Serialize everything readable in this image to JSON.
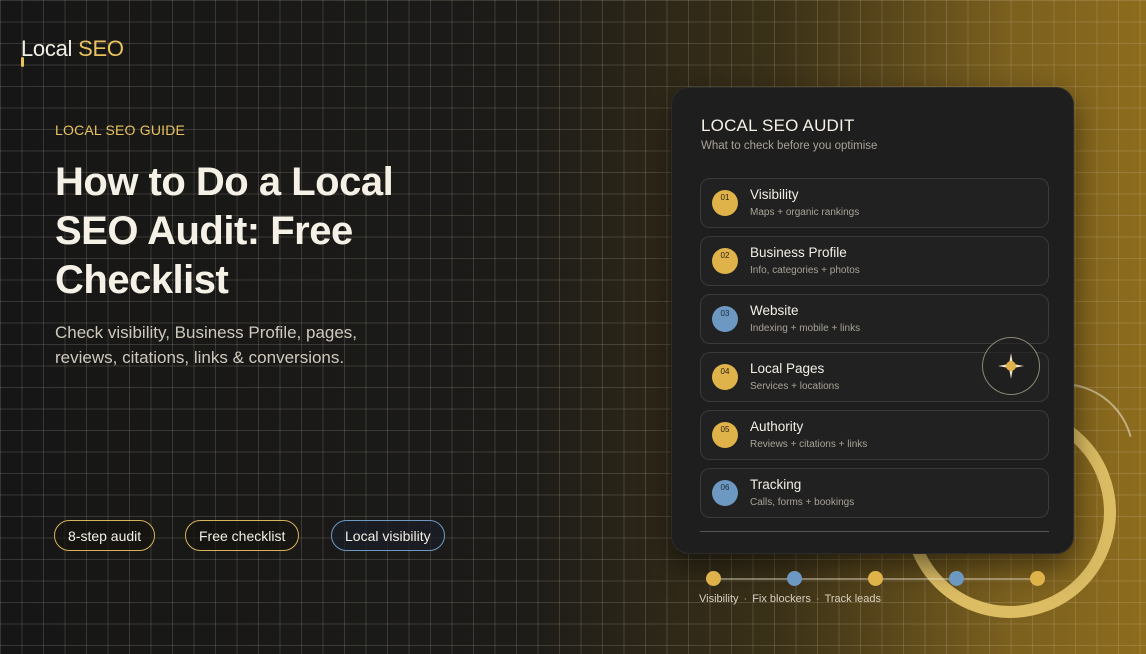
{
  "logo": {
    "part1": "Local",
    "part2": "SEO"
  },
  "hero": {
    "eyebrow": "LOCAL SEO GUIDE",
    "headline": "How to Do a Local SEO Audit: Free Checklist",
    "subtitle": "Check visibility, Business Profile, pages, reviews, citations, links & conversions."
  },
  "pills": [
    "8-step audit",
    "Free checklist",
    "Local visibility"
  ],
  "card": {
    "title": "LOCAL SEO AUDIT",
    "subtitle": "What to check before you optimise",
    "items": [
      {
        "num": "01",
        "title": "Visibility",
        "desc": "Maps + organic rankings",
        "color": "#e0b24a"
      },
      {
        "num": "02",
        "title": "Business Profile",
        "desc": "Info, categories + photos",
        "color": "#e0b24a"
      },
      {
        "num": "03",
        "title": "Website",
        "desc": "Indexing + mobile + links",
        "color": "#6d98c2"
      },
      {
        "num": "04",
        "title": "Local Pages",
        "desc": "Services + locations",
        "color": "#e0b24a"
      },
      {
        "num": "05",
        "title": "Authority",
        "desc": "Reviews + citations + links",
        "color": "#e0b24a"
      },
      {
        "num": "06",
        "title": "Tracking",
        "desc": "Calls, forms + bookings",
        "color": "#6d98c2"
      }
    ]
  },
  "timeline": {
    "labels": [
      "Visibility",
      "Fix blockers",
      "Track leads"
    ],
    "separator": "·"
  },
  "colors": {
    "gold": "#e0b24a",
    "blue": "#6d98c2",
    "card_bg": "#1e1e1e"
  },
  "icons": {
    "sparkle": "sparkle-icon"
  }
}
